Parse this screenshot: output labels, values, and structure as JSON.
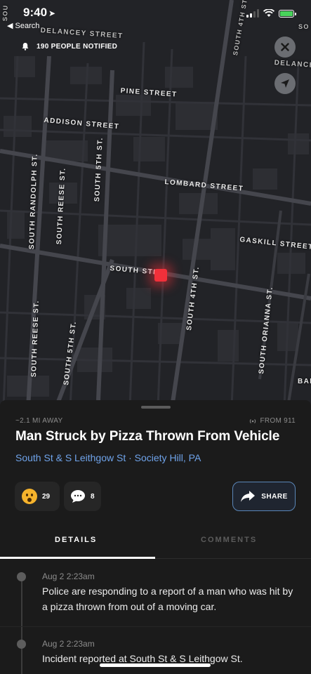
{
  "status_bar": {
    "time": "9:40",
    "back_label": "Search"
  },
  "map": {
    "notified_text": "190 PEOPLE NOTIFIED",
    "streets": {
      "delancey_street": "DELANCEY STREET",
      "pine_street": "PINE STREET",
      "addison_street": "ADDISON STREET",
      "lombard_street": "LOMBARD STREET",
      "gaskill_street": "GASKILL STREET",
      "south_street": "SOUTH STR",
      "south_randolph": "SOUTH RANDOLPH ST.",
      "south_reese_upper": "SOUTH REESE ST.",
      "south_5th_upper": "SOUTH 5TH ST.",
      "south_reese_lower": "SOUTH REESE ST.",
      "south_5th_lower": "SOUTH 5TH ST.",
      "south_4th": "SOUTH 4TH ST.",
      "south_orianna": "SOUTH ORIANNA ST.",
      "south_4th_top": "SOUTH 4TH ST",
      "delance_right": "DELANCE",
      "ban_right": "BAI",
      "sou_left": "SOU",
      "so_right": "SO"
    },
    "marker_color": "#f0303a"
  },
  "incident": {
    "distance": "~2.1 MI AWAY",
    "source": "FROM 911",
    "title": "Man Struck by Pizza Thrown From Vehicle",
    "location": "South St & S Leithgow St · Society Hill, PA",
    "reaction_count": "29",
    "comment_count": "8",
    "share_label": "SHARE"
  },
  "tabs": {
    "details": "DETAILS",
    "comments": "COMMENTS"
  },
  "updates": [
    {
      "time": "Aug 2 2:23am",
      "text": "Police are responding to a report of a man who was hit by a pizza thrown from out of a moving car."
    },
    {
      "time": "Aug 2 2:23am",
      "text": "Incident reported at South St & S Leithgow St."
    }
  ],
  "colors": {
    "accent_link": "#6fa3ea",
    "battery": "#49d35b",
    "background": "#161616"
  }
}
